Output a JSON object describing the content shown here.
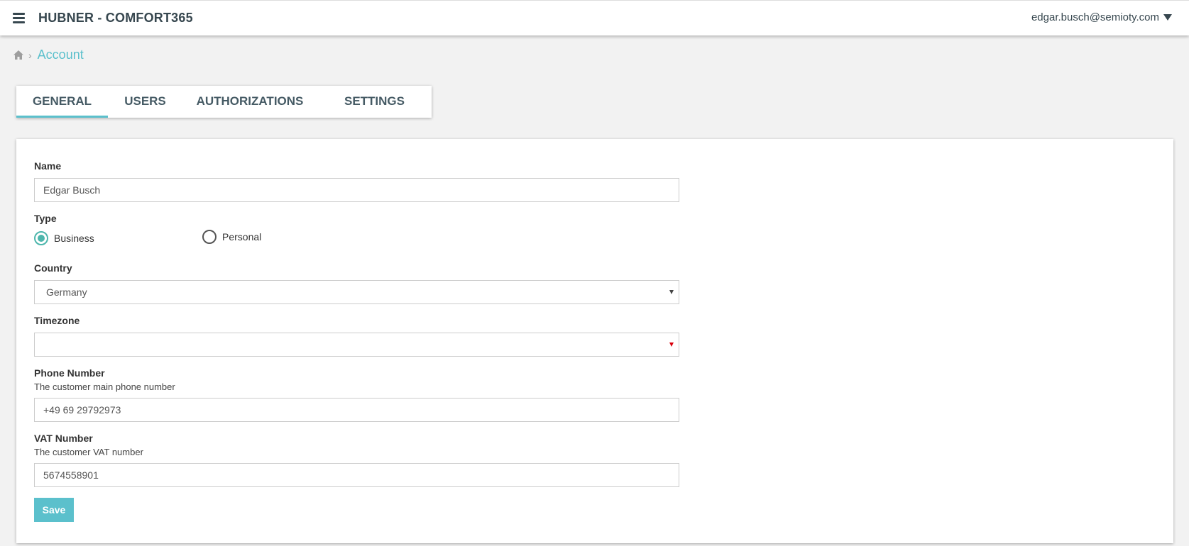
{
  "header": {
    "app_title": "HUBNER - COMFORT365",
    "user_email": "edgar.busch@semioty.com"
  },
  "breadcrumb": {
    "home_icon": "home-icon",
    "separator": "›",
    "current": "Account"
  },
  "tabs": [
    {
      "label": "GENERAL",
      "active": true
    },
    {
      "label": "USERS",
      "active": false
    },
    {
      "label": "AUTHORIZATIONS",
      "active": false
    },
    {
      "label": "SETTINGS",
      "active": false
    }
  ],
  "form": {
    "name": {
      "label": "Name",
      "value": "Edgar Busch"
    },
    "type": {
      "label": "Type",
      "options": [
        {
          "label": "Business",
          "checked": true
        },
        {
          "label": "Personal",
          "checked": false
        }
      ]
    },
    "country": {
      "label": "Country",
      "value": "Germany"
    },
    "timezone": {
      "label": "Timezone",
      "value": ""
    },
    "phone": {
      "label": "Phone Number",
      "help": "The customer main phone number",
      "value": "+49 69 29792973"
    },
    "vat": {
      "label": "VAT Number",
      "help": "The customer VAT number",
      "value": "5674558901"
    },
    "save_label": "Save"
  },
  "colors": {
    "accent": "#5bc0cc",
    "radio_checked": "#4db6ac",
    "text_dark": "#37474f",
    "required_arrow": "#d9000d"
  }
}
